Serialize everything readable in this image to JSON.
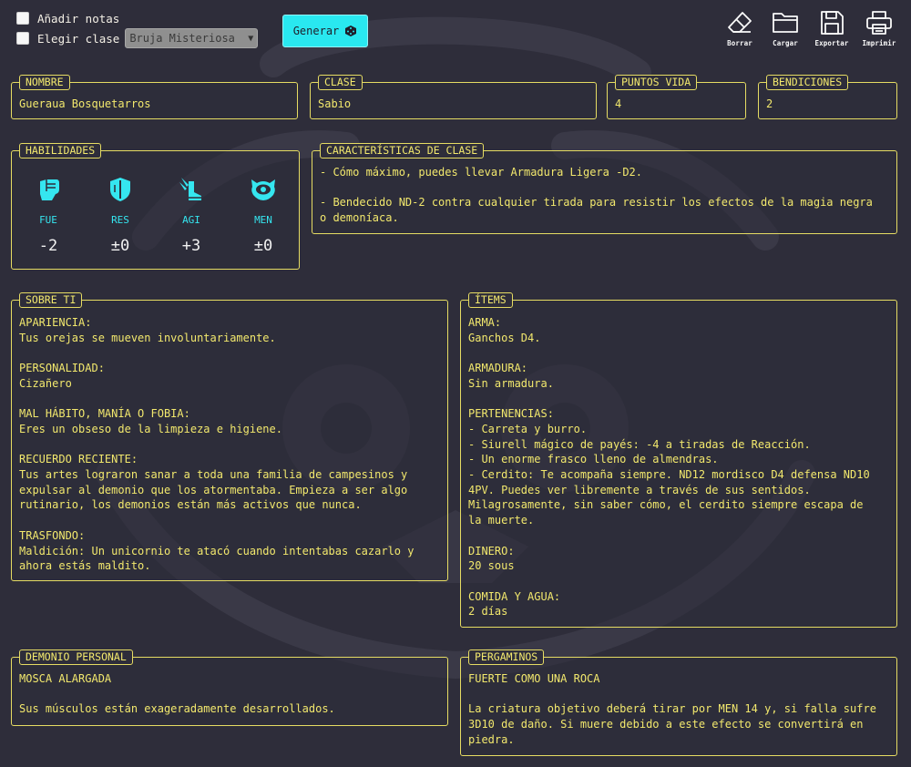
{
  "controls": {
    "notes_label": "Añadir notas",
    "class_label": "Elegir clase",
    "class_select_value": "Bruja Misteriosa",
    "generate_label": "Generar"
  },
  "toolbar": [
    {
      "label": "Borrar",
      "icon": "eraser-icon"
    },
    {
      "label": "Cargar",
      "icon": "folder-icon"
    },
    {
      "label": "Exportar",
      "icon": "floppy-icon"
    },
    {
      "label": "Imprimir",
      "icon": "printer-icon"
    }
  ],
  "fields": {
    "nombre": {
      "label": "NOMBRE",
      "value": "Gueraua Bosquetarros"
    },
    "clase": {
      "label": "CLASE",
      "value": "Sabio"
    },
    "puntos_vida": {
      "label": "PUNTOS VIDA",
      "value": "4"
    },
    "bendiciones": {
      "label": "BENDICIONES",
      "value": "2"
    }
  },
  "habilidades": {
    "label": "HABILIDADES",
    "stats": [
      {
        "abbr": "FUE",
        "value": "-2",
        "icon": "fist-icon"
      },
      {
        "abbr": "RES",
        "value": "±0",
        "icon": "shield-icon"
      },
      {
        "abbr": "AGI",
        "value": "+3",
        "icon": "winged-boot-icon"
      },
      {
        "abbr": "MEN",
        "value": "±0",
        "icon": "brain-eye-icon"
      }
    ]
  },
  "caracteristicas": {
    "label": "CARACTERÍSTICAS DE CLASE",
    "text": "- Cómo máximo, puedes llevar Armadura Ligera -D2.\n\n- Bendecido ND-2 contra cualquier tirada para resistir los efectos de la magia negra\no demoníaca."
  },
  "sobre_ti": {
    "label": "SOBRE TI",
    "text": "APARIENCIA:\nTus orejas se mueven involuntariamente.\n\nPERSONALIDAD:\nCizañero\n\nMAL HÁBITO, MANÍA O FOBIA:\nEres un obseso de la limpieza e higiene.\n\nRECUERDO RECIENTE:\nTus artes lograron sanar a toda una familia de campesinos y\nexpulsar al demonio que los atormentaba. Empieza a ser algo\nrutinario, los demonios están más activos que nunca.\n\nTRASFONDO:\nMaldición: Un unicornio te atacó cuando intentabas cazarlo y\nahora estás maldito."
  },
  "items": {
    "label": "ÍTEMS",
    "text": "ARMA:\nGanchos D4.\n\nARMADURA:\nSin armadura.\n\nPERTENENCIAS:\n- Carreta y burro.\n- Siurell mágico de payés: -4 a tiradas de Reacción.\n- Un enorme frasco lleno de almendras.\n- Cerdito: Te acompaña siempre. ND12 mordisco D4 defensa ND10\n4PV. Puedes ver libremente a través de sus sentidos.\nMilagrosamente, sin saber cómo, el cerdito siempre escapa de\nla muerte.\n\nDINERO:\n20 sous\n\nCOMIDA Y AGUA:\n2 días"
  },
  "demonio": {
    "label": "DEMONIO PERSONAL",
    "text": "MOSCA ALARGADA\n\nSus músculos están exageradamente desarrollados."
  },
  "pergaminos": {
    "label": "PERGAMINOS",
    "text": "FUERTE COMO UNA ROCA\n\nLa criatura objetivo deberá tirar por MEN 14 y, si falla sufre\n3D10 de daño. Si muere debido a este efecto se convertirá en\npiedra."
  },
  "colors": {
    "background": "#2e2d3a",
    "text_yellow": "#f2e86d",
    "accent_cyan": "#29e8f0",
    "border": "#e6dc63"
  }
}
